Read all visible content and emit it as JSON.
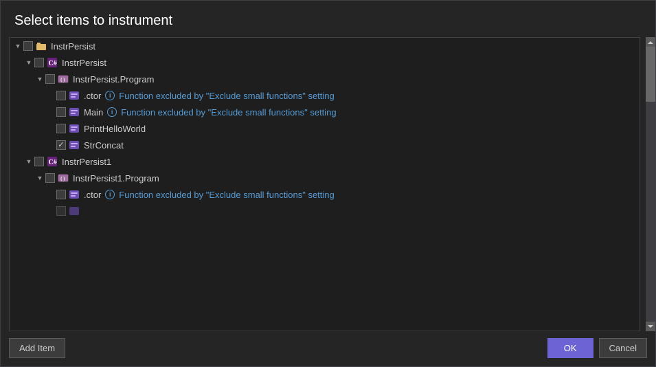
{
  "dialog": {
    "title": "Select items to instrument",
    "add_item_label": "Add Item",
    "ok_label": "OK",
    "cancel_label": "Cancel"
  },
  "tree": {
    "items": [
      {
        "id": "instrpersist-root",
        "level": 0,
        "expanded": true,
        "checkbox": "partial",
        "icon": "project",
        "label": "InstrPersist",
        "excluded": false,
        "info": false
      },
      {
        "id": "instrpersist-project",
        "level": 1,
        "expanded": true,
        "checkbox": "partial",
        "icon": "project-c",
        "label": "InstrPersist",
        "excluded": false,
        "info": false
      },
      {
        "id": "instrpersist-program",
        "level": 2,
        "expanded": true,
        "checkbox": "partial",
        "icon": "namespace",
        "label": "InstrPersist.Program",
        "excluded": false,
        "info": false
      },
      {
        "id": "ctor1",
        "level": 3,
        "expanded": false,
        "checkbox": "unchecked",
        "icon": "method",
        "label": ".ctor",
        "excluded": true,
        "info": true,
        "excluded_text": "Function excluded by \"Exclude small functions\" setting"
      },
      {
        "id": "main",
        "level": 3,
        "expanded": false,
        "checkbox": "unchecked",
        "icon": "method",
        "label": "Main",
        "excluded": true,
        "info": true,
        "excluded_text": "Function excluded by \"Exclude small functions\" setting"
      },
      {
        "id": "printhelloworld",
        "level": 3,
        "expanded": false,
        "checkbox": "unchecked",
        "icon": "method",
        "label": "PrintHelloWorld",
        "excluded": false,
        "info": false
      },
      {
        "id": "strconcat",
        "level": 3,
        "expanded": false,
        "checkbox": "checked",
        "icon": "method",
        "label": "StrConcat",
        "excluded": false,
        "info": false
      },
      {
        "id": "instrpersist1-project",
        "level": 1,
        "expanded": true,
        "checkbox": "partial",
        "icon": "project-c",
        "label": "InstrPersist1",
        "excluded": false,
        "info": false
      },
      {
        "id": "instrpersist1-program",
        "level": 2,
        "expanded": true,
        "checkbox": "partial",
        "icon": "namespace",
        "label": "InstrPersist1.Program",
        "excluded": false,
        "info": false
      },
      {
        "id": "ctor2",
        "level": 3,
        "expanded": false,
        "checkbox": "unchecked",
        "icon": "method",
        "label": ".ctor",
        "excluded": true,
        "info": true,
        "excluded_text": "Function excluded by \"Exclude small functions\" setting"
      }
    ]
  }
}
